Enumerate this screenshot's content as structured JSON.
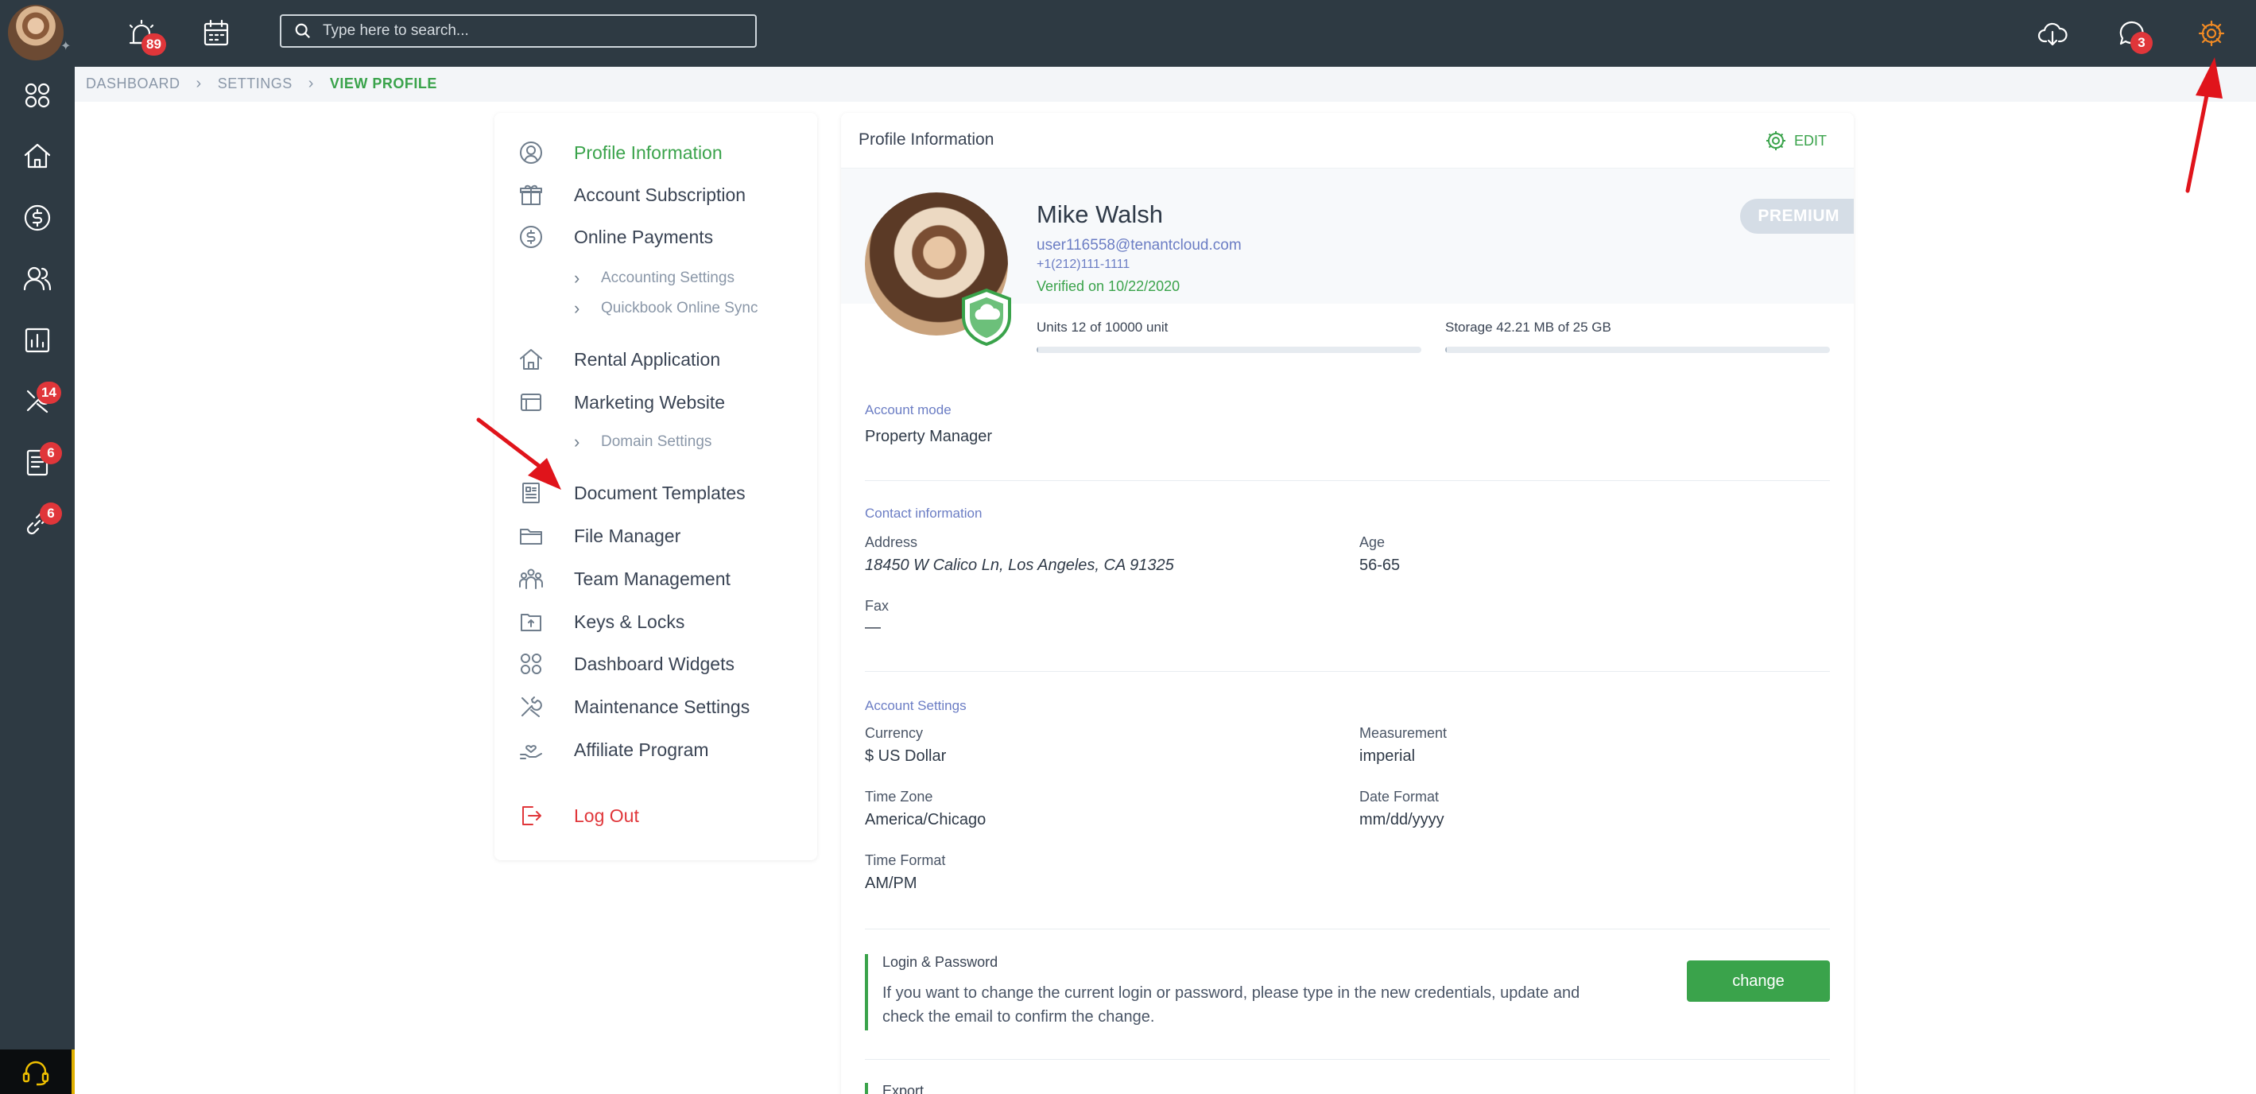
{
  "topbar": {
    "alerts_badge": "89",
    "search_placeholder": "Type here to search...",
    "messages_badge": "3"
  },
  "sidebar": {
    "maintenance_badge": "14",
    "documents_badge": "6",
    "links_badge": "6"
  },
  "breadcrumb": [
    "DASHBOARD",
    "SETTINGS",
    "VIEW PROFILE"
  ],
  "menu": {
    "items": [
      {
        "label": "Profile Information",
        "icon": "user-circle-icon",
        "active": true
      },
      {
        "label": "Account Subscription",
        "icon": "gift-icon"
      },
      {
        "label": "Online Payments",
        "icon": "dollar-circle-icon"
      },
      {
        "label": "Rental Application",
        "icon": "home-icon"
      },
      {
        "label": "Marketing Website",
        "icon": "browser-window-icon"
      },
      {
        "label": "Document Templates",
        "icon": "document-template-icon"
      },
      {
        "label": "File Manager",
        "icon": "folder-icon"
      },
      {
        "label": "Team Management",
        "icon": "team-icon"
      },
      {
        "label": "Keys & Locks",
        "icon": "key-lock-icon"
      },
      {
        "label": "Dashboard Widgets",
        "icon": "widgets-icon"
      },
      {
        "label": "Maintenance Settings",
        "icon": "tools-icon"
      },
      {
        "label": "Affiliate Program",
        "icon": "hand-heart-icon"
      },
      {
        "label": "Log Out",
        "icon": "logout-icon"
      }
    ],
    "subitems": {
      "accounting": "Accounting Settings",
      "quickbook": "Quickbook Online Sync",
      "domain": "Domain Settings"
    }
  },
  "profile": {
    "card_title": "Profile Information",
    "edit_label": "EDIT",
    "badge": "PREMIUM",
    "name": "Mike Walsh",
    "email": "user116558@tenantcloud.com",
    "phone": "+1(212)111-1111",
    "verified": "Verified on 10/22/2020",
    "units_label": "Units 12 of 10000 unit",
    "units_fraction": 0.0012,
    "storage_label": "Storage 42.21 MB of 25 GB",
    "storage_fraction": 0.0017,
    "account_mode_title": "Account mode",
    "account_mode": "Property Manager",
    "contact_title": "Contact information",
    "address_label": "Address",
    "address": "18450 W Calico Ln, Los Angeles, CA 91325",
    "age_label": "Age",
    "age": "56-65",
    "fax_label": "Fax",
    "fax": "—",
    "settings_title": "Account Settings",
    "currency_label": "Currency",
    "currency": "$ US Dollar",
    "measurement_label": "Measurement",
    "measurement": "imperial",
    "timezone_label": "Time Zone",
    "timezone": "America/Chicago",
    "dateformat_label": "Date Format",
    "dateformat": "mm/dd/yyyy",
    "timeformat_label": "Time Format",
    "timeformat": "AM/PM",
    "login_title": "Login & Password",
    "login_text": "If you want to change the current login or password, please type in the new credentials, update and check the email to confirm the change.",
    "change_label": "change",
    "export_title": "Export"
  },
  "colors": {
    "sidebar_bg": "#2e3a43",
    "accent_green": "#3aa34b",
    "danger_red": "#e0363a",
    "link_blue": "#6b7dc4",
    "settings_icon_orange": "#f08a24"
  }
}
